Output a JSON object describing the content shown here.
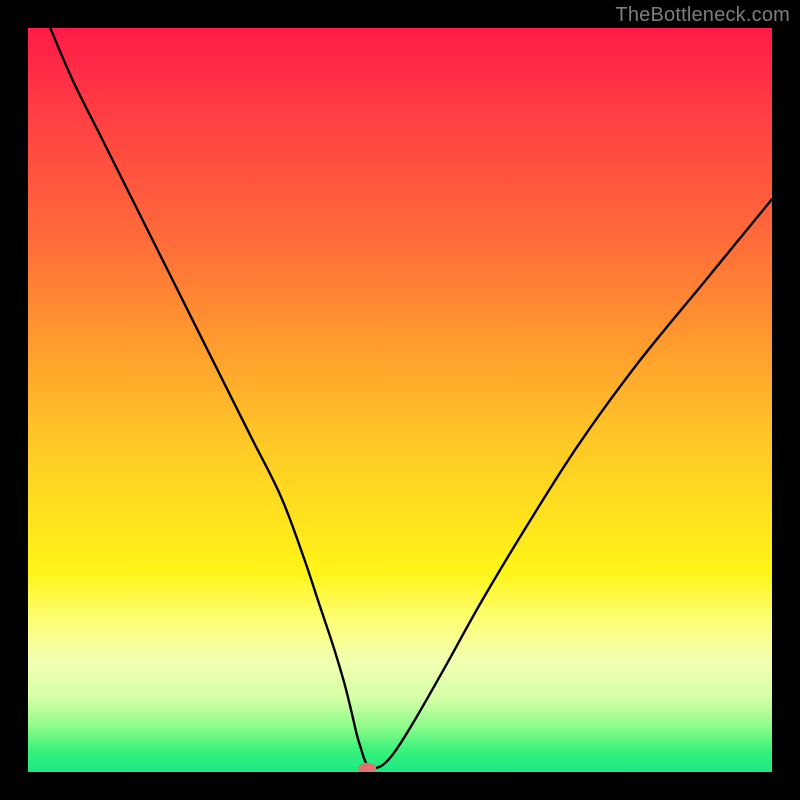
{
  "watermark": "TheBottleneck.com",
  "chart_data": {
    "type": "line",
    "title": "",
    "xlabel": "",
    "ylabel": "",
    "xlim": [
      0,
      100
    ],
    "ylim": [
      0,
      100
    ],
    "series": [
      {
        "name": "bottleneck-curve",
        "x": [
          3,
          6,
          10,
          14,
          18,
          22,
          26,
          30,
          34,
          37,
          39,
          41,
          42.5,
          43.5,
          44.2,
          44.8,
          45.3,
          45.8,
          46.3,
          47,
          48,
          49.5,
          52,
          56,
          61,
          67,
          74,
          82,
          91,
          100
        ],
        "y": [
          100,
          93,
          85,
          77,
          69,
          61,
          53,
          45,
          37,
          29,
          23,
          17,
          12,
          8,
          5,
          3,
          1.5,
          0.8,
          0.5,
          0.6,
          1.2,
          3,
          7,
          14,
          23,
          33,
          44,
          55,
          66,
          77
        ]
      }
    ],
    "marker": {
      "x": 45.6,
      "y": 0.45,
      "color": "#e2746f"
    },
    "gradient_stops": [
      {
        "pos": 0,
        "color": "#ff1a47"
      },
      {
        "pos": 28,
        "color": "#ff6a3a"
      },
      {
        "pos": 55,
        "color": "#ffc627"
      },
      {
        "pos": 73,
        "color": "#fff417"
      },
      {
        "pos": 90,
        "color": "#d6ffa8"
      },
      {
        "pos": 100,
        "color": "#1de884"
      }
    ]
  }
}
